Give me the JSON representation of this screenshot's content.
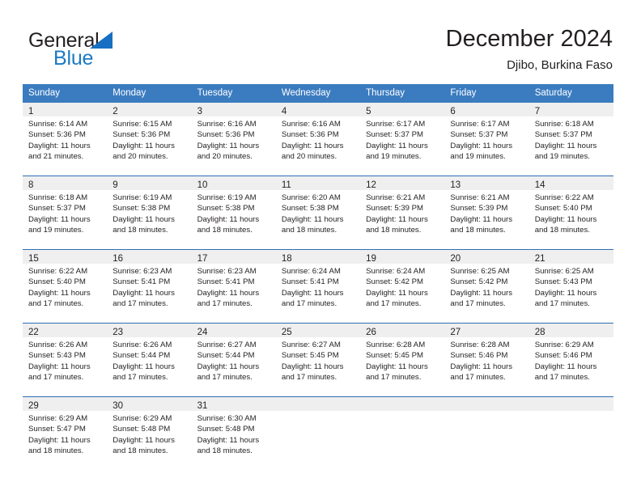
{
  "brand": {
    "name_top": "General",
    "name_bottom": "Blue",
    "accent_color": "#1a7ac4"
  },
  "header": {
    "title": "December 2024",
    "subtitle": "Djibo, Burkina Faso"
  },
  "theme": {
    "header_blue": "#3b7cc0",
    "row_divider_blue": "#2f6fb5",
    "daynum_band": "#efefef",
    "text": "#231f20"
  },
  "weekday_headers": [
    "Sunday",
    "Monday",
    "Tuesday",
    "Wednesday",
    "Thursday",
    "Friday",
    "Saturday"
  ],
  "weeks": [
    [
      {
        "day": "1",
        "sunrise": "Sunrise: 6:14 AM",
        "sunset": "Sunset: 5:36 PM",
        "daylight1": "Daylight: 11 hours",
        "daylight2": "and 21 minutes."
      },
      {
        "day": "2",
        "sunrise": "Sunrise: 6:15 AM",
        "sunset": "Sunset: 5:36 PM",
        "daylight1": "Daylight: 11 hours",
        "daylight2": "and 20 minutes."
      },
      {
        "day": "3",
        "sunrise": "Sunrise: 6:16 AM",
        "sunset": "Sunset: 5:36 PM",
        "daylight1": "Daylight: 11 hours",
        "daylight2": "and 20 minutes."
      },
      {
        "day": "4",
        "sunrise": "Sunrise: 6:16 AM",
        "sunset": "Sunset: 5:36 PM",
        "daylight1": "Daylight: 11 hours",
        "daylight2": "and 20 minutes."
      },
      {
        "day": "5",
        "sunrise": "Sunrise: 6:17 AM",
        "sunset": "Sunset: 5:37 PM",
        "daylight1": "Daylight: 11 hours",
        "daylight2": "and 19 minutes."
      },
      {
        "day": "6",
        "sunrise": "Sunrise: 6:17 AM",
        "sunset": "Sunset: 5:37 PM",
        "daylight1": "Daylight: 11 hours",
        "daylight2": "and 19 minutes."
      },
      {
        "day": "7",
        "sunrise": "Sunrise: 6:18 AM",
        "sunset": "Sunset: 5:37 PM",
        "daylight1": "Daylight: 11 hours",
        "daylight2": "and 19 minutes."
      }
    ],
    [
      {
        "day": "8",
        "sunrise": "Sunrise: 6:18 AM",
        "sunset": "Sunset: 5:37 PM",
        "daylight1": "Daylight: 11 hours",
        "daylight2": "and 19 minutes."
      },
      {
        "day": "9",
        "sunrise": "Sunrise: 6:19 AM",
        "sunset": "Sunset: 5:38 PM",
        "daylight1": "Daylight: 11 hours",
        "daylight2": "and 18 minutes."
      },
      {
        "day": "10",
        "sunrise": "Sunrise: 6:19 AM",
        "sunset": "Sunset: 5:38 PM",
        "daylight1": "Daylight: 11 hours",
        "daylight2": "and 18 minutes."
      },
      {
        "day": "11",
        "sunrise": "Sunrise: 6:20 AM",
        "sunset": "Sunset: 5:38 PM",
        "daylight1": "Daylight: 11 hours",
        "daylight2": "and 18 minutes."
      },
      {
        "day": "12",
        "sunrise": "Sunrise: 6:21 AM",
        "sunset": "Sunset: 5:39 PM",
        "daylight1": "Daylight: 11 hours",
        "daylight2": "and 18 minutes."
      },
      {
        "day": "13",
        "sunrise": "Sunrise: 6:21 AM",
        "sunset": "Sunset: 5:39 PM",
        "daylight1": "Daylight: 11 hours",
        "daylight2": "and 18 minutes."
      },
      {
        "day": "14",
        "sunrise": "Sunrise: 6:22 AM",
        "sunset": "Sunset: 5:40 PM",
        "daylight1": "Daylight: 11 hours",
        "daylight2": "and 18 minutes."
      }
    ],
    [
      {
        "day": "15",
        "sunrise": "Sunrise: 6:22 AM",
        "sunset": "Sunset: 5:40 PM",
        "daylight1": "Daylight: 11 hours",
        "daylight2": "and 17 minutes."
      },
      {
        "day": "16",
        "sunrise": "Sunrise: 6:23 AM",
        "sunset": "Sunset: 5:41 PM",
        "daylight1": "Daylight: 11 hours",
        "daylight2": "and 17 minutes."
      },
      {
        "day": "17",
        "sunrise": "Sunrise: 6:23 AM",
        "sunset": "Sunset: 5:41 PM",
        "daylight1": "Daylight: 11 hours",
        "daylight2": "and 17 minutes."
      },
      {
        "day": "18",
        "sunrise": "Sunrise: 6:24 AM",
        "sunset": "Sunset: 5:41 PM",
        "daylight1": "Daylight: 11 hours",
        "daylight2": "and 17 minutes."
      },
      {
        "day": "19",
        "sunrise": "Sunrise: 6:24 AM",
        "sunset": "Sunset: 5:42 PM",
        "daylight1": "Daylight: 11 hours",
        "daylight2": "and 17 minutes."
      },
      {
        "day": "20",
        "sunrise": "Sunrise: 6:25 AM",
        "sunset": "Sunset: 5:42 PM",
        "daylight1": "Daylight: 11 hours",
        "daylight2": "and 17 minutes."
      },
      {
        "day": "21",
        "sunrise": "Sunrise: 6:25 AM",
        "sunset": "Sunset: 5:43 PM",
        "daylight1": "Daylight: 11 hours",
        "daylight2": "and 17 minutes."
      }
    ],
    [
      {
        "day": "22",
        "sunrise": "Sunrise: 6:26 AM",
        "sunset": "Sunset: 5:43 PM",
        "daylight1": "Daylight: 11 hours",
        "daylight2": "and 17 minutes."
      },
      {
        "day": "23",
        "sunrise": "Sunrise: 6:26 AM",
        "sunset": "Sunset: 5:44 PM",
        "daylight1": "Daylight: 11 hours",
        "daylight2": "and 17 minutes."
      },
      {
        "day": "24",
        "sunrise": "Sunrise: 6:27 AM",
        "sunset": "Sunset: 5:44 PM",
        "daylight1": "Daylight: 11 hours",
        "daylight2": "and 17 minutes."
      },
      {
        "day": "25",
        "sunrise": "Sunrise: 6:27 AM",
        "sunset": "Sunset: 5:45 PM",
        "daylight1": "Daylight: 11 hours",
        "daylight2": "and 17 minutes."
      },
      {
        "day": "26",
        "sunrise": "Sunrise: 6:28 AM",
        "sunset": "Sunset: 5:45 PM",
        "daylight1": "Daylight: 11 hours",
        "daylight2": "and 17 minutes."
      },
      {
        "day": "27",
        "sunrise": "Sunrise: 6:28 AM",
        "sunset": "Sunset: 5:46 PM",
        "daylight1": "Daylight: 11 hours",
        "daylight2": "and 17 minutes."
      },
      {
        "day": "28",
        "sunrise": "Sunrise: 6:29 AM",
        "sunset": "Sunset: 5:46 PM",
        "daylight1": "Daylight: 11 hours",
        "daylight2": "and 17 minutes."
      }
    ],
    [
      {
        "day": "29",
        "sunrise": "Sunrise: 6:29 AM",
        "sunset": "Sunset: 5:47 PM",
        "daylight1": "Daylight: 11 hours",
        "daylight2": "and 18 minutes."
      },
      {
        "day": "30",
        "sunrise": "Sunrise: 6:29 AM",
        "sunset": "Sunset: 5:48 PM",
        "daylight1": "Daylight: 11 hours",
        "daylight2": "and 18 minutes."
      },
      {
        "day": "31",
        "sunrise": "Sunrise: 6:30 AM",
        "sunset": "Sunset: 5:48 PM",
        "daylight1": "Daylight: 11 hours",
        "daylight2": "and 18 minutes."
      },
      {
        "day": "",
        "sunrise": "",
        "sunset": "",
        "daylight1": "",
        "daylight2": ""
      },
      {
        "day": "",
        "sunrise": "",
        "sunset": "",
        "daylight1": "",
        "daylight2": ""
      },
      {
        "day": "",
        "sunrise": "",
        "sunset": "",
        "daylight1": "",
        "daylight2": ""
      },
      {
        "day": "",
        "sunrise": "",
        "sunset": "",
        "daylight1": "",
        "daylight2": ""
      }
    ]
  ]
}
